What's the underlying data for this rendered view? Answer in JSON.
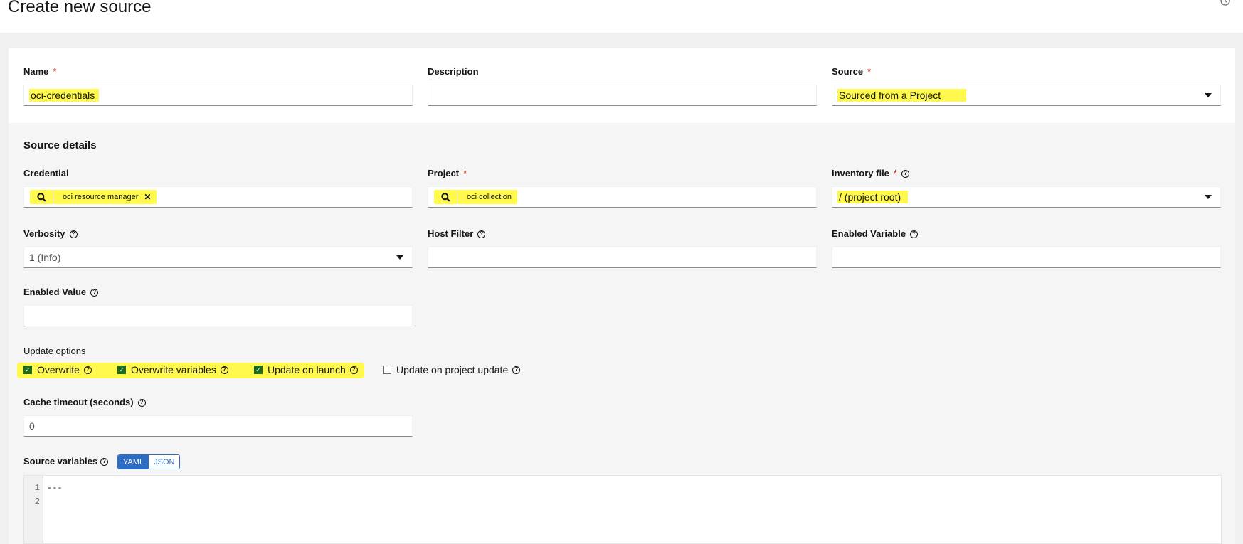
{
  "page": {
    "title": "Create new source"
  },
  "form": {
    "name": {
      "label": "Name",
      "required": "*",
      "value": "oci-credentials"
    },
    "description": {
      "label": "Description",
      "value": ""
    },
    "source": {
      "label": "Source",
      "required": "*",
      "value": "Sourced from a Project"
    },
    "section_title": "Source details",
    "credential": {
      "label": "Credential",
      "chip": "oci resource manager"
    },
    "project": {
      "label": "Project",
      "required": "*",
      "chip": "oci collection"
    },
    "inventory_file": {
      "label": "Inventory file",
      "required": "*",
      "value": "/ (project root)"
    },
    "verbosity": {
      "label": "Verbosity",
      "value": "1 (Info)"
    },
    "host_filter": {
      "label": "Host Filter",
      "value": ""
    },
    "enabled_variable": {
      "label": "Enabled Variable",
      "value": ""
    },
    "enabled_value": {
      "label": "Enabled Value",
      "value": ""
    },
    "update_options": {
      "label": "Update options",
      "items": [
        {
          "label": "Overwrite",
          "checked": true
        },
        {
          "label": "Overwrite variables",
          "checked": true
        },
        {
          "label": "Update on launch",
          "checked": true
        },
        {
          "label": "Update on project update",
          "checked": false
        }
      ]
    },
    "cache_timeout": {
      "label": "Cache timeout (seconds)",
      "value": "0"
    },
    "source_variables": {
      "label": "Source variables",
      "toggle": [
        "YAML",
        "JSON"
      ],
      "selected": "YAML",
      "line_numbers": [
        "1",
        "2"
      ],
      "code": "---"
    }
  },
  "icons": {
    "help": "question-circle-icon",
    "search": "search-icon",
    "caret": "caret-down-icon",
    "history": "history-icon"
  },
  "colors": {
    "highlight": "#fff94d",
    "accent": "#2b6cc4",
    "required": "#c9190b"
  }
}
